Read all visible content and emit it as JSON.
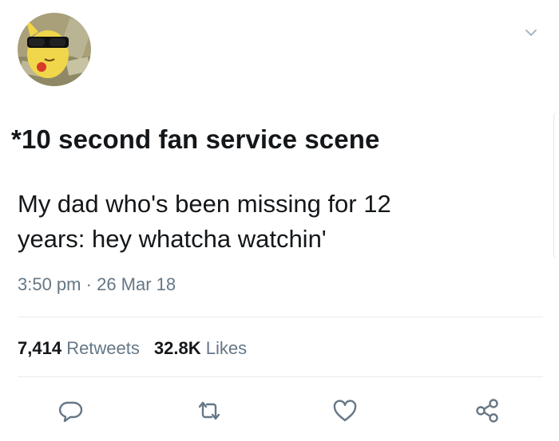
{
  "tweet": {
    "header_line": "*10 second fan service scene",
    "body_lines": [
      "My dad who's been missing for 12",
      "years: hey whatcha watchin'"
    ],
    "time": "3:50 pm",
    "separator": "·",
    "date": "26 Mar 18"
  },
  "stats": {
    "retweets_count": "7,414",
    "retweets_label": "Retweets",
    "likes_count": "32.8K",
    "likes_label": "Likes"
  },
  "icons": {
    "avatar": "pikachu-sunglasses-avatar",
    "menu": "chevron-down-icon",
    "reply": "reply-bubble-icon",
    "retweet": "retweet-icon",
    "like": "heart-icon",
    "share": "share-icon"
  },
  "colors": {
    "text": "#14171a",
    "secondary_text": "#657786",
    "divider": "#e6ecf0",
    "icon": "#657786"
  }
}
